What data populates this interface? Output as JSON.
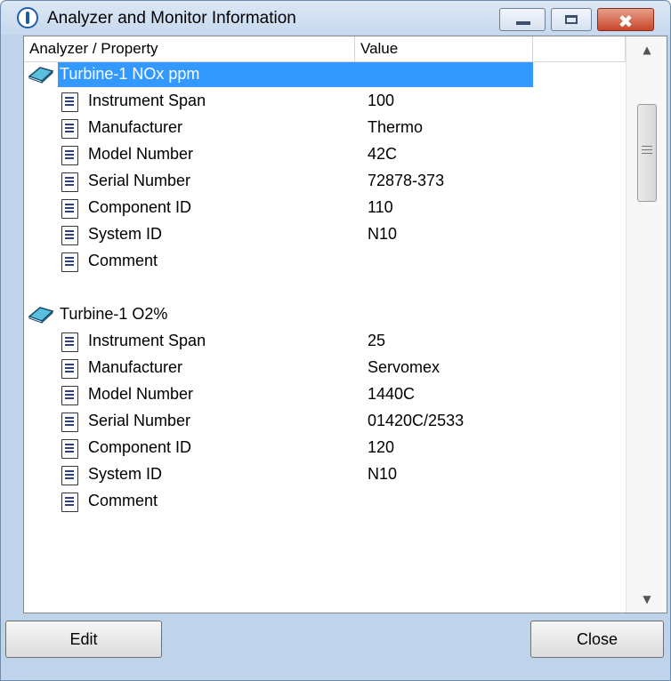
{
  "window": {
    "title": "Analyzer and Monitor Information",
    "minimize_icon": "minimize-icon",
    "maximize_icon": "maximize-icon",
    "close_glyph": "✖"
  },
  "table": {
    "columns": [
      "Analyzer / Property",
      "Value",
      ""
    ],
    "groups": [
      {
        "name": "Turbine-1 NOx ppm",
        "selected": true,
        "icon": "analyzer-book-icon",
        "properties": [
          {
            "label": "Instrument Span",
            "value": "100"
          },
          {
            "label": "Manufacturer",
            "value": "Thermo"
          },
          {
            "label": "Model Number",
            "value": "42C"
          },
          {
            "label": "Serial Number",
            "value": "72878-373"
          },
          {
            "label": "Component ID",
            "value": "110"
          },
          {
            "label": "System ID",
            "value": "N10"
          },
          {
            "label": "Comment",
            "value": ""
          }
        ]
      },
      {
        "name": "Turbine-1 O2%",
        "selected": false,
        "icon": "analyzer-book-icon",
        "properties": [
          {
            "label": "Instrument Span",
            "value": "25"
          },
          {
            "label": "Manufacturer",
            "value": "Servomex"
          },
          {
            "label": "Model Number",
            "value": "1440C"
          },
          {
            "label": "Serial Number",
            "value": "01420C/2533"
          },
          {
            "label": "Component ID",
            "value": "120"
          },
          {
            "label": "System ID",
            "value": "N10"
          },
          {
            "label": "Comment",
            "value": ""
          }
        ]
      }
    ]
  },
  "buttons": {
    "edit": "Edit",
    "close": "Close"
  },
  "colors": {
    "selection": "#3399ff",
    "titlebar": "#c7d9ee",
    "close_button": "#c8452a"
  }
}
